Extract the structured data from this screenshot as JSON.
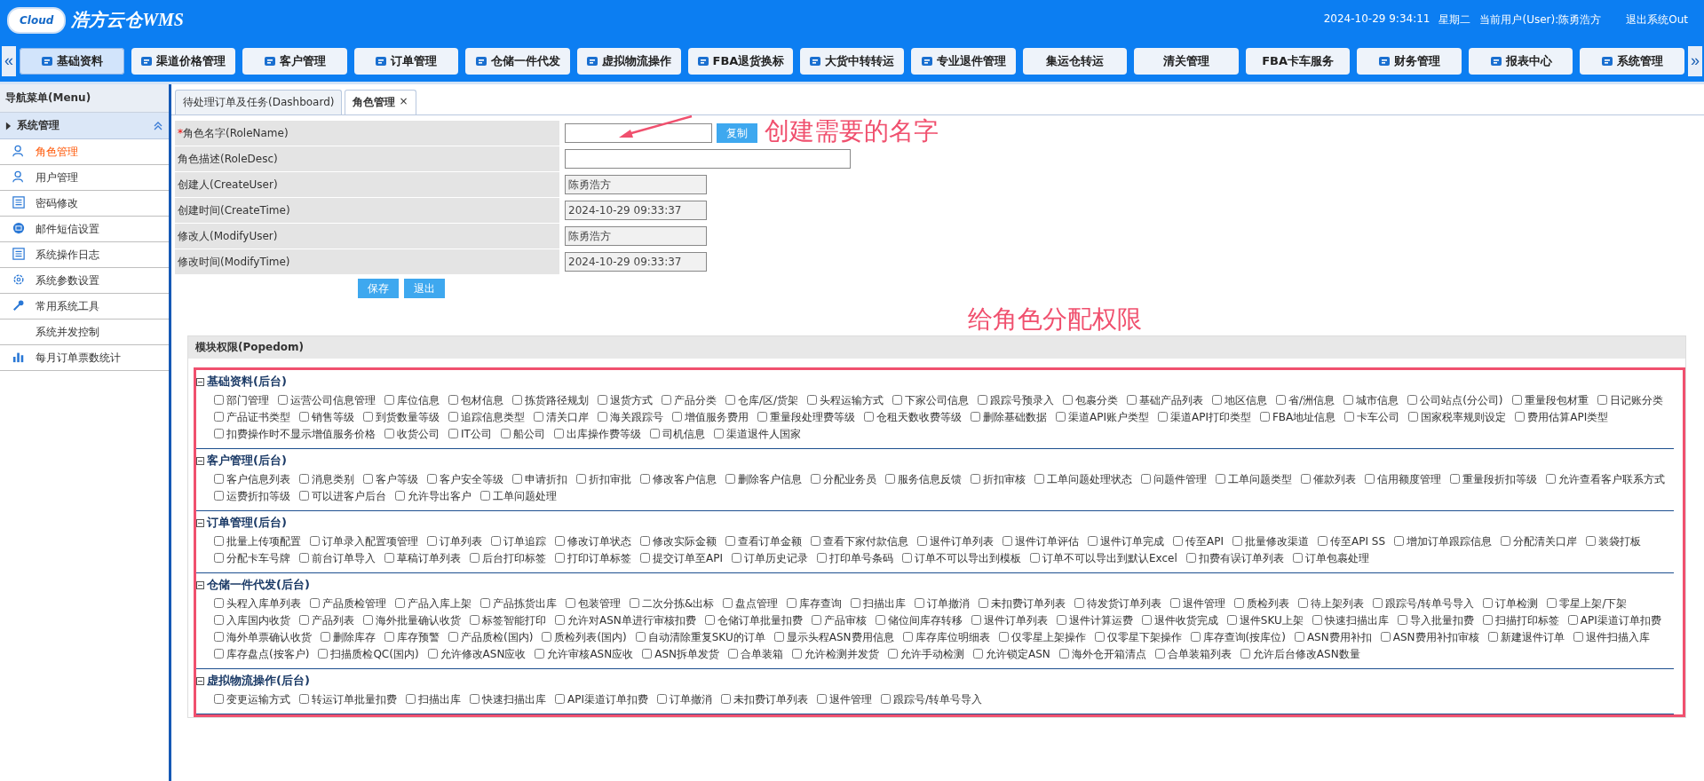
{
  "header": {
    "logo_badge": "Cloud",
    "title": "浩方云仓WMS",
    "datetime": "2024-10-29 9:34:11",
    "weekday": "星期二",
    "user": "当前用户(User):陈勇浩方",
    "logout": "退出系统Out"
  },
  "nav": {
    "prev": "«",
    "next": "»",
    "items": [
      {
        "label": "基础资料",
        "selected": true,
        "has_icon": true
      },
      {
        "label": "渠道价格管理",
        "selected": false,
        "has_icon": true
      },
      {
        "label": "客户管理",
        "selected": false,
        "has_icon": true
      },
      {
        "label": "订单管理",
        "selected": false,
        "has_icon": true
      },
      {
        "label": "仓储一件代发",
        "selected": false,
        "has_icon": true
      },
      {
        "label": "虚拟物流操作",
        "selected": false,
        "has_icon": true
      },
      {
        "label": "FBA退货换标",
        "selected": false,
        "has_icon": true
      },
      {
        "label": "大货中转转运",
        "selected": false,
        "has_icon": true
      },
      {
        "label": "专业退件管理",
        "selected": false,
        "has_icon": true
      },
      {
        "label": "集运仓转运",
        "selected": false,
        "has_icon": false
      },
      {
        "label": "清关管理",
        "selected": false,
        "has_icon": false
      },
      {
        "label": "FBA卡车服务",
        "selected": false,
        "has_icon": false
      },
      {
        "label": "财务管理",
        "selected": false,
        "has_icon": true
      },
      {
        "label": "报表中心",
        "selected": false,
        "has_icon": true
      },
      {
        "label": "系统管理",
        "selected": false,
        "has_icon": true
      }
    ]
  },
  "sidebar": {
    "title": "导航菜单(Menu)",
    "group": {
      "label": "系统管理",
      "expanded": true
    },
    "items": [
      {
        "label": "角色管理",
        "kind": "user",
        "selected": true
      },
      {
        "label": "用户管理",
        "kind": "user",
        "selected": false
      },
      {
        "label": "密码修改",
        "kind": "list",
        "selected": false
      },
      {
        "label": "邮件短信设置",
        "kind": "mail",
        "selected": false
      },
      {
        "label": "系统操作日志",
        "kind": "list",
        "selected": false
      },
      {
        "label": "系统参数设置",
        "kind": "gear",
        "selected": false
      },
      {
        "label": "常用系统工具",
        "kind": "wrench",
        "selected": false
      },
      {
        "label": "系统并发控制",
        "kind": "none",
        "selected": false
      },
      {
        "label": "每月订单票数统计",
        "kind": "chart",
        "selected": false
      }
    ]
  },
  "tabs": [
    {
      "label": "待处理订单及任务(Dashboard)",
      "selected": false,
      "closable": false
    },
    {
      "label": "角色管理",
      "selected": true,
      "closable": true,
      "close": "×"
    }
  ],
  "form": {
    "rows": [
      {
        "label": "角色名字(RoleName)",
        "required_mark": "*",
        "kind": "input",
        "value": "",
        "button": "复制"
      },
      {
        "label": "角色描述(RoleDesc)",
        "kind": "wide-input",
        "value": ""
      },
      {
        "label": "创建人(CreateUser)",
        "kind": "readonly",
        "value": "陈勇浩方"
      },
      {
        "label": "创建时间(CreateTime)",
        "kind": "readonly",
        "value": "2024-10-29 09:33:37"
      },
      {
        "label": "修改人(ModifyUser)",
        "kind": "readonly",
        "value": "陈勇浩方"
      },
      {
        "label": "修改时间(ModifyTime)",
        "kind": "readonly",
        "value": "2024-10-29 09:33:37"
      }
    ],
    "buttons": [
      "保存",
      "退出"
    ]
  },
  "popedom": {
    "title": "模块权限(Popedom)",
    "sections": [
      {
        "title": "基础资料(后台)",
        "expanded": true,
        "items": [
          {
            "label": "部门管理",
            "checked": false
          },
          {
            "label": "运营公司信息管理",
            "checked": false
          },
          {
            "label": "库位信息",
            "checked": false
          },
          {
            "label": "包材信息",
            "checked": false
          },
          {
            "label": "拣货路径规划",
            "checked": false
          },
          {
            "label": "退货方式",
            "checked": false
          },
          {
            "label": "产品分类",
            "checked": false
          },
          {
            "label": "仓库/区/货架",
            "checked": false
          },
          {
            "label": "头程运输方式",
            "checked": false
          },
          {
            "label": "下家公司信息",
            "checked": false
          },
          {
            "label": "跟踪号预录入",
            "checked": false
          },
          {
            "label": "包裹分类",
            "checked": false
          },
          {
            "label": "基础产品列表",
            "checked": false
          },
          {
            "label": "地区信息",
            "checked": false
          },
          {
            "label": "省/洲信息",
            "checked": false
          },
          {
            "label": "城市信息",
            "checked": false
          },
          {
            "label": "公司站点(分公司)",
            "checked": false
          },
          {
            "label": "重量段包材重",
            "checked": false
          },
          {
            "label": "日记账分类",
            "checked": false
          },
          {
            "label": "产品证书类型",
            "checked": false
          },
          {
            "label": "销售等级",
            "checked": false
          },
          {
            "label": "到货数量等级",
            "checked": false
          },
          {
            "label": "追踪信息类型",
            "checked": false
          },
          {
            "label": "清关口岸",
            "checked": false
          },
          {
            "label": "海关跟踪号",
            "checked": false
          },
          {
            "label": "增值服务费用",
            "checked": false
          },
          {
            "label": "重量段处理费等级",
            "checked": false
          },
          {
            "label": "仓租天数收费等级",
            "checked": false
          },
          {
            "label": "删除基础数据",
            "checked": false
          },
          {
            "label": "渠道API账户类型",
            "checked": false
          },
          {
            "label": "渠道API打印类型",
            "checked": false
          },
          {
            "label": "FBA地址信息",
            "checked": false
          },
          {
            "label": "卡车公司",
            "checked": false
          },
          {
            "label": "国家税率规则设定",
            "checked": false
          },
          {
            "label": "费用估算API类型",
            "checked": false
          },
          {
            "label": "扣费操作时不显示增值服务价格",
            "checked": false
          },
          {
            "label": "收货公司",
            "checked": false
          },
          {
            "label": "IT公司",
            "checked": false
          },
          {
            "label": "船公司",
            "checked": false
          },
          {
            "label": "出库操作费等级",
            "checked": false
          },
          {
            "label": "司机信息",
            "checked": false
          },
          {
            "label": "渠道退件人国家",
            "checked": false
          }
        ]
      },
      {
        "title": "客户管理(后台)",
        "expanded": true,
        "items": [
          {
            "label": "客户信息列表",
            "checked": false
          },
          {
            "label": "消息类别",
            "checked": false
          },
          {
            "label": "客户等级",
            "checked": false
          },
          {
            "label": "客户安全等级",
            "checked": false
          },
          {
            "label": "申请折扣",
            "checked": false
          },
          {
            "label": "折扣审批",
            "checked": false
          },
          {
            "label": "修改客户信息",
            "checked": false
          },
          {
            "label": "删除客户信息",
            "checked": false
          },
          {
            "label": "分配业务员",
            "checked": false
          },
          {
            "label": "服务信息反馈",
            "checked": false
          },
          {
            "label": "折扣审核",
            "checked": false
          },
          {
            "label": "工单问题处理状态",
            "checked": false
          },
          {
            "label": "问题件管理",
            "checked": false
          },
          {
            "label": "工单问题类型",
            "checked": false
          },
          {
            "label": "催款列表",
            "checked": false
          },
          {
            "label": "信用额度管理",
            "checked": false
          },
          {
            "label": "重量段折扣等级",
            "checked": false
          },
          {
            "label": "允许查看客户联系方式",
            "checked": false
          },
          {
            "label": "运费折扣等级",
            "checked": false
          },
          {
            "label": "可以进客户后台",
            "checked": false
          },
          {
            "label": "允许导出客户",
            "checked": false
          },
          {
            "label": "工单问题处理",
            "checked": false
          }
        ]
      },
      {
        "title": "订单管理(后台)",
        "expanded": true,
        "items": [
          {
            "label": "批量上传项配置",
            "checked": false
          },
          {
            "label": "订单录入配置项管理",
            "checked": false
          },
          {
            "label": "订单列表",
            "checked": false
          },
          {
            "label": "订单追踪",
            "checked": false
          },
          {
            "label": "修改订单状态",
            "checked": false
          },
          {
            "label": "修改实际金额",
            "checked": false
          },
          {
            "label": "查看订单金额",
            "checked": false
          },
          {
            "label": "查看下家付款信息",
            "checked": false
          },
          {
            "label": "退件订单列表",
            "checked": false
          },
          {
            "label": "退件订单评估",
            "checked": false
          },
          {
            "label": "退件订单完成",
            "checked": false
          },
          {
            "label": "传至API",
            "checked": false
          },
          {
            "label": "批量修改渠道",
            "checked": false
          },
          {
            "label": "传至API SS",
            "checked": false
          },
          {
            "label": "增加订单跟踪信息",
            "checked": false
          },
          {
            "label": "分配清关口岸",
            "checked": false
          },
          {
            "label": "装袋打板",
            "checked": false
          },
          {
            "label": "分配卡车号牌",
            "checked": false
          },
          {
            "label": "前台订单导入",
            "checked": false
          },
          {
            "label": "草稿订单列表",
            "checked": false
          },
          {
            "label": "后台打印标签",
            "checked": false
          },
          {
            "label": "打印订单标签",
            "checked": false
          },
          {
            "label": "提交订单至API",
            "checked": false
          },
          {
            "label": "订单历史记录",
            "checked": false
          },
          {
            "label": "打印单号条码",
            "checked": false
          },
          {
            "label": "订单不可以导出到模板",
            "checked": false
          },
          {
            "label": "订单不可以导出到默认Excel",
            "checked": false
          },
          {
            "label": "扣费有误订单列表",
            "checked": false
          },
          {
            "label": "订单包裹处理",
            "checked": false
          }
        ]
      },
      {
        "title": "仓储一件代发(后台)",
        "expanded": true,
        "items": [
          {
            "label": "头程入库单列表",
            "checked": false
          },
          {
            "label": "产品质检管理",
            "checked": false
          },
          {
            "label": "产品入库上架",
            "checked": false
          },
          {
            "label": "产品拣货出库",
            "checked": false
          },
          {
            "label": "包装管理",
            "checked": false
          },
          {
            "label": "二次分拣&出标",
            "checked": false
          },
          {
            "label": "盘点管理",
            "checked": false
          },
          {
            "label": "库存查询",
            "checked": false
          },
          {
            "label": "扫描出库",
            "checked": false
          },
          {
            "label": "订单撤消",
            "checked": false
          },
          {
            "label": "未扣费订单列表",
            "checked": false
          },
          {
            "label": "待发货订单列表",
            "checked": false
          },
          {
            "label": "退件管理",
            "checked": false
          },
          {
            "label": "质检列表",
            "checked": false
          },
          {
            "label": "待上架列表",
            "checked": false
          },
          {
            "label": "跟踪号/转单号导入",
            "checked": false
          },
          {
            "label": "订单检测",
            "checked": false
          },
          {
            "label": "零星上架/下架",
            "checked": false
          },
          {
            "label": "入库国内收货",
            "checked": false
          },
          {
            "label": "产品列表",
            "checked": false
          },
          {
            "label": "海外批量确认收货",
            "checked": false
          },
          {
            "label": "标签智能打印",
            "checked": false
          },
          {
            "label": "允许对ASN单进行审核扣费",
            "checked": false
          },
          {
            "label": "仓储订单批量扣费",
            "checked": false
          },
          {
            "label": "产品审核",
            "checked": false
          },
          {
            "label": "储位间库存转移",
            "checked": false
          },
          {
            "label": "退件订单列表",
            "checked": false
          },
          {
            "label": "退件计算运费",
            "checked": false
          },
          {
            "label": "退件收货完成",
            "checked": false
          },
          {
            "label": "退件SKU上架",
            "checked": false
          },
          {
            "label": "快速扫描出库",
            "checked": false
          },
          {
            "label": "导入批量扣费",
            "checked": false
          },
          {
            "label": "扫描打印标签",
            "checked": false
          },
          {
            "label": "API渠道订单扣费",
            "checked": false
          },
          {
            "label": "海外单票确认收货",
            "checked": false
          },
          {
            "label": "删除库存",
            "checked": false
          },
          {
            "label": "库存预警",
            "checked": false
          },
          {
            "label": "产品质检(国内)",
            "checked": false
          },
          {
            "label": "质检列表(国内)",
            "checked": false
          },
          {
            "label": "自动清除重复SKU的订单",
            "checked": false
          },
          {
            "label": "显示头程ASN费用信息",
            "checked": false
          },
          {
            "label": "库存库位明细表",
            "checked": false
          },
          {
            "label": "仅零星上架操作",
            "checked": false
          },
          {
            "label": "仅零星下架操作",
            "checked": false
          },
          {
            "label": "库存查询(按库位)",
            "checked": false
          },
          {
            "label": "ASN费用补扣",
            "checked": false
          },
          {
            "label": "ASN费用补扣审核",
            "checked": false
          },
          {
            "label": "新建退件订单",
            "checked": false
          },
          {
            "label": "退件扫描入库",
            "checked": false
          },
          {
            "label": "库存盘点(按客户)",
            "checked": false
          },
          {
            "label": "扫描质检QC(国内)",
            "checked": false
          },
          {
            "label": "允许修改ASN应收",
            "checked": false
          },
          {
            "label": "允许审核ASN应收",
            "checked": false
          },
          {
            "label": "ASN拆单发货",
            "checked": false
          },
          {
            "label": "合单装箱",
            "checked": false
          },
          {
            "label": "允许检测并发货",
            "checked": false
          },
          {
            "label": "允许手动检测",
            "checked": false
          },
          {
            "label": "允许锁定ASN",
            "checked": false
          },
          {
            "label": "海外仓开箱清点",
            "checked": false
          },
          {
            "label": "合单装箱列表",
            "checked": false
          },
          {
            "label": "允许后台修改ASN数量",
            "checked": false
          }
        ]
      },
      {
        "title": "虚拟物流操作(后台)",
        "expanded": true,
        "items": [
          {
            "label": "变更运输方式",
            "checked": false
          },
          {
            "label": "转运订单批量扣费",
            "checked": false
          },
          {
            "label": "扫描出库",
            "checked": false
          },
          {
            "label": "快速扫描出库",
            "checked": false
          },
          {
            "label": "API渠道订单扣费",
            "checked": false
          },
          {
            "label": "订单撤消",
            "checked": false
          },
          {
            "label": "未扣费订单列表",
            "checked": false
          },
          {
            "label": "退件管理",
            "checked": false
          },
          {
            "label": "跟踪号/转单号导入",
            "checked": false
          }
        ]
      }
    ]
  },
  "annotations": [
    {
      "text": "创建需要的名字"
    },
    {
      "text": "给角色分配权限"
    }
  ]
}
